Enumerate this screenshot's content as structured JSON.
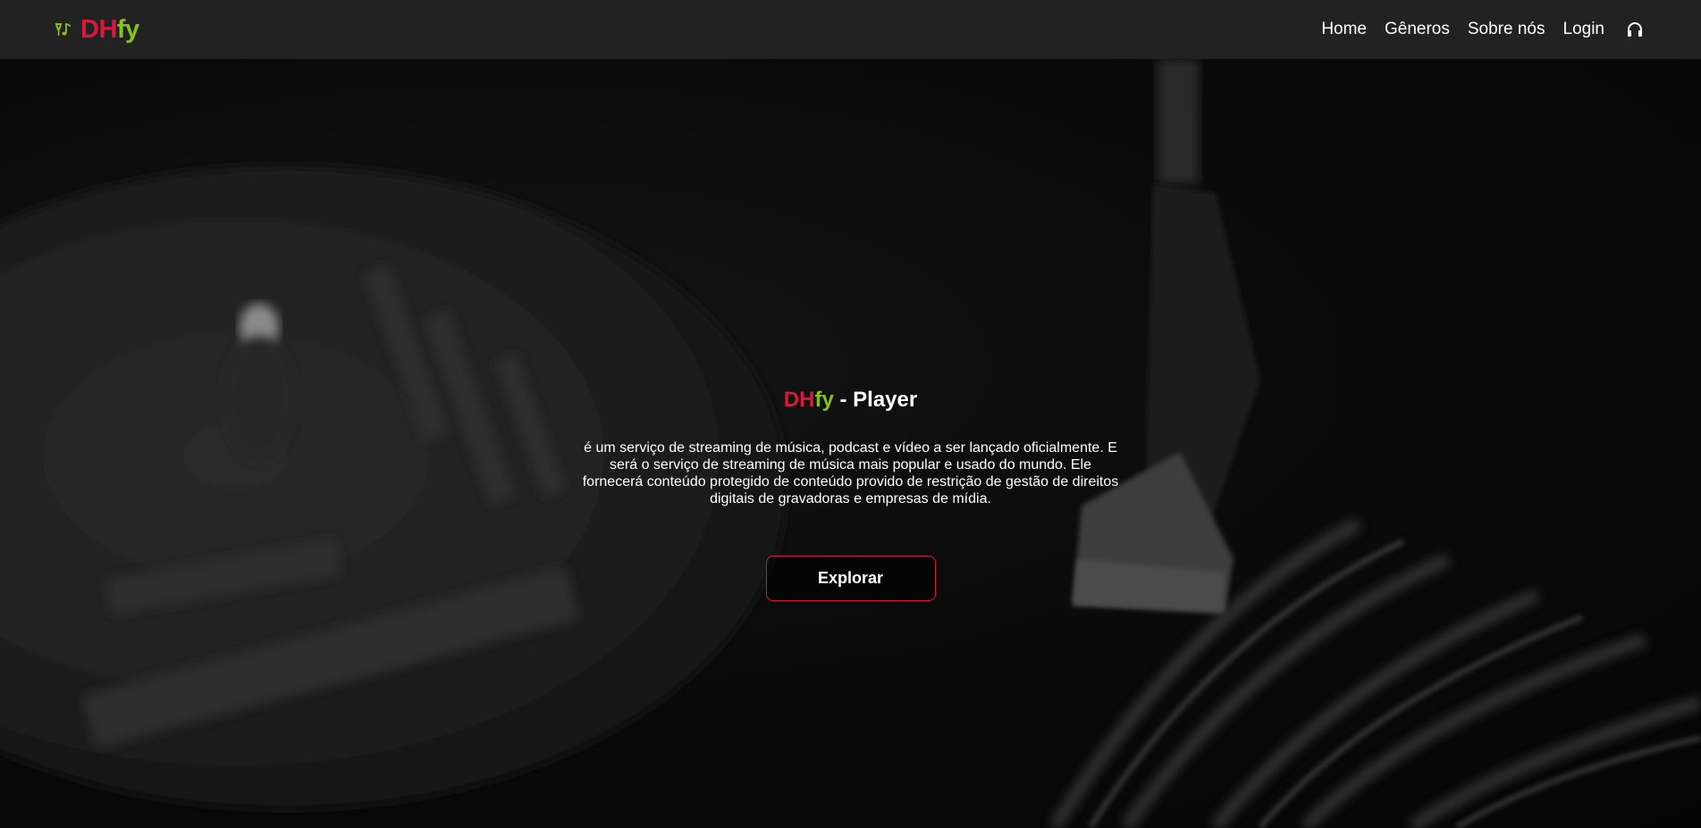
{
  "navbar": {
    "brand": {
      "part1": "DH",
      "part2": "fy"
    },
    "links": [
      {
        "label": "Home"
      },
      {
        "label": "Gêneros"
      },
      {
        "label": "Sobre nós"
      },
      {
        "label": "Login"
      }
    ],
    "icons": {
      "brand": "music-notes-icon",
      "action": "headphones-icon"
    }
  },
  "hero": {
    "title": {
      "part1": "DH",
      "part2": "fy",
      "suffix": " - Player"
    },
    "description": "é um serviço de streaming de música, podcast e vídeo a ser lançado oficialmente. E será o serviço de streaming de música mais popular e usado do mundo. Ele fornecerá conteúdo protegido de conteúdo provido de restrição de gestão de direitos digitais de gravadoras e empresas de mídia.",
    "button": {
      "label": "Explorar"
    }
  },
  "colors": {
    "navbar_bg": "#222222",
    "brand_red": "#d6193f",
    "brand_green": "#86c11c",
    "button_border": "#d6193f",
    "text": "#ffffff"
  }
}
